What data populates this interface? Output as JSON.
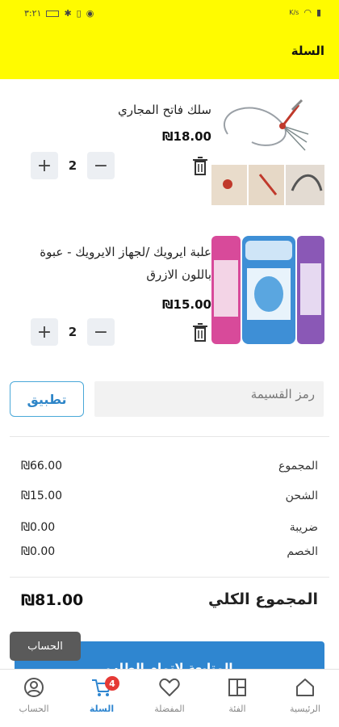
{
  "status_bar": {
    "time": "٣:٢١",
    "network": "K/s"
  },
  "header": {
    "title": "السلة"
  },
  "items": [
    {
      "title": "سلك فاتح المجاري",
      "price": "₪18.00",
      "quantity": "2"
    },
    {
      "title": "علبة ايرويك /لجهاز الايرويك - عبوة باللون الازرق",
      "price": "₪15.00",
      "quantity": "2"
    }
  ],
  "coupon": {
    "placeholder": "رمز القسيمة",
    "apply_label": "تطبيق"
  },
  "summary": {
    "rows": [
      {
        "label": "المجموع",
        "value": "₪66.00"
      },
      {
        "label": "الشحن",
        "value": "₪15.00"
      },
      {
        "label": "ضريبة",
        "value": "₪0.00"
      },
      {
        "label": "الخصم",
        "value": "₪0.00"
      }
    ],
    "total_label": "المجموع الكلي",
    "total_value": "₪81.00"
  },
  "checkout_label": "المتابعة لإتمام الطلب",
  "tooltip": "الحساب",
  "bottom_nav": {
    "home": "الرئيسية",
    "category": "الفئة",
    "favorites": "المفضلة",
    "cart": "السلة",
    "account": "الحساب",
    "cart_badge": "4"
  },
  "colors": {
    "header": "#fffb00",
    "accent": "#2f86d0",
    "badge": "#e53935"
  }
}
